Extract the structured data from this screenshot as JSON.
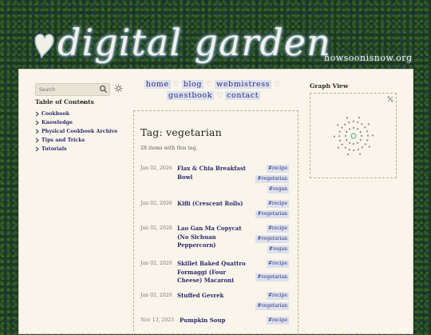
{
  "site": {
    "title": "digital garden",
    "domain": "howsoonisnow.org"
  },
  "search": {
    "placeholder": "Search"
  },
  "toc": {
    "title": "Table of Contents",
    "items": [
      {
        "label": "Cookbook"
      },
      {
        "label": "Knowledge"
      },
      {
        "label": "Physical Cookbook Archive"
      },
      {
        "label": "Tips and Tricks"
      },
      {
        "label": "Tutorials"
      }
    ]
  },
  "nav": {
    "links": [
      "home",
      "blog",
      "webmistress",
      "guestbook",
      "contact"
    ],
    "separator": "♡"
  },
  "graph": {
    "title": "Graph View"
  },
  "page": {
    "title": "Tag: vegetarian",
    "count_text": "28 items with this tag."
  },
  "items": [
    {
      "date": "Jan 02, 2026",
      "title": "Flax & Chia Breakfast Bowl",
      "tags": [
        "#recipe",
        "#vegetarian",
        "#vegan"
      ]
    },
    {
      "date": "Jan 02, 2026",
      "title": "Kifli (Crescent Rolls)",
      "tags": [
        "#recipe",
        "#vegetarian"
      ]
    },
    {
      "date": "Jan 02, 2026",
      "title": "Lao Gan Ma Copycat (No Sichuan Peppercorn)",
      "tags": [
        "#recipe",
        "#vegetarian",
        "#vegan"
      ]
    },
    {
      "date": "Jan 02, 2026",
      "title": "Skillet Baked Quattro Formaggi (Four Cheese) Macaroni",
      "tags": [
        "#recipe",
        "#vegetarian"
      ]
    },
    {
      "date": "Jan 02, 2026",
      "title": "Stuffed Gevrek",
      "tags": [
        "#recipe",
        "#vegetarian"
      ]
    },
    {
      "date": "Nov 13, 2025",
      "title": "Pumpkin Soup",
      "tags": [
        "#recipe"
      ]
    }
  ],
  "colors": {
    "link": "#2b2a6e",
    "tag_bg": "#dde1ee",
    "panel_bg": "#faf5ea",
    "graph_node": "#8a8a8a",
    "graph_center": "#6fb08a"
  },
  "icons": {
    "search": "search-icon",
    "theme": "sun-icon",
    "toc_toggle": "chevron-down-icon",
    "toc_item": "chevron-right-icon",
    "graph_expand": "expand-icon",
    "logo": "heart-logo-icon"
  }
}
